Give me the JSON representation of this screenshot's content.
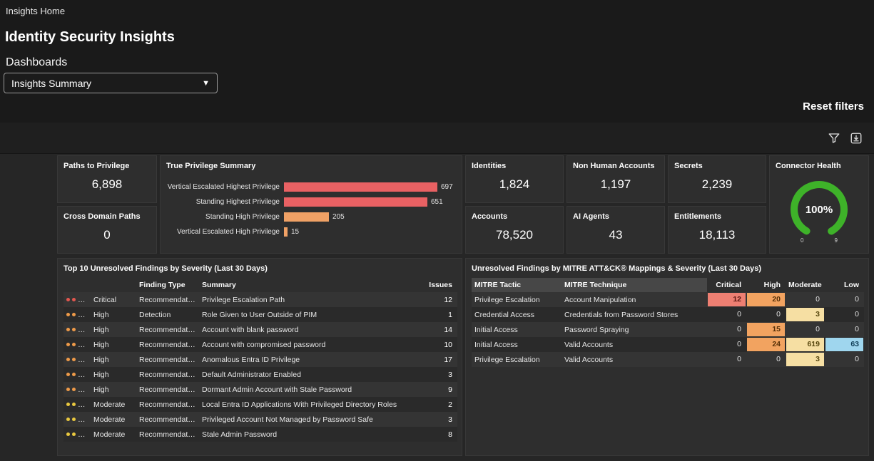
{
  "page": {
    "breadcrumb": "Insights Home",
    "title": "Identity Security Insights",
    "dashboards_label": "Dashboards",
    "dashboard_selected": "Insights Summary",
    "reset_filters": "Reset filters"
  },
  "toolbar": {
    "icons": [
      "filter-icon",
      "download-icon"
    ]
  },
  "kpis": [
    {
      "label": "Paths to Privilege",
      "value": "6,898"
    },
    {
      "label": "Cross Domain Paths",
      "value": "0"
    },
    {
      "label": "Identities",
      "value": "1,824"
    },
    {
      "label": "Accounts",
      "value": "78,520"
    },
    {
      "label": "Non Human Accounts",
      "value": "1,197"
    },
    {
      "label": "AI Agents",
      "value": "43"
    },
    {
      "label": "Secrets",
      "value": "2,239"
    },
    {
      "label": "Entitlements",
      "value": "18,113"
    }
  ],
  "connector_health": {
    "label": "Connector Health",
    "value": "100%",
    "gauge_min": "0",
    "gauge_max": "9",
    "color": "#3eb229"
  },
  "chart_data": [
    {
      "type": "bar",
      "title": "True Privilege Summary",
      "orientation": "horizontal",
      "categories": [
        "Vertical Escalated Highest Privilege",
        "Standing Highest Privilege",
        "Standing High Privilege",
        "Vertical Escalated High Privilege"
      ],
      "values": [
        697,
        651,
        205,
        15
      ],
      "value_labels": [
        "697",
        "651",
        "205",
        "15"
      ],
      "colors": [
        "#e96163",
        "#e96163",
        "#f0a165",
        "#f0a165"
      ],
      "xlim": [
        0,
        697
      ],
      "grid": false,
      "legend": false
    },
    {
      "type": "gauge",
      "title": "Connector Health",
      "value": 100,
      "unit": "%",
      "scale_min": 0,
      "scale_max": 9
    }
  ],
  "severity_colors": {
    "Critical": "#e2574f",
    "High": "#ee9a49",
    "Moderate": "#e9c83f"
  },
  "findings_table": {
    "title": "Top 10 Unresolved Findings by Severity (Last 30 Days)",
    "columns": {
      "finding_type": "Finding Type",
      "summary": "Summary",
      "issues": "Issues"
    },
    "dots_total": 4,
    "rows": [
      {
        "severity": "Critical",
        "dots": 4,
        "type": "Recommendation",
        "summary": "Privilege Escalation Path",
        "issues": "12"
      },
      {
        "severity": "High",
        "dots": 3,
        "type": "Detection",
        "summary": "Role Given to User Outside of PIM",
        "issues": "1"
      },
      {
        "severity": "High",
        "dots": 3,
        "type": "Recommendation",
        "summary": "Account with blank password",
        "issues": "14"
      },
      {
        "severity": "High",
        "dots": 3,
        "type": "Recommendation",
        "summary": "Account with compromised password",
        "issues": "10"
      },
      {
        "severity": "High",
        "dots": 3,
        "type": "Recommendation",
        "summary": "Anomalous Entra ID Privilege",
        "issues": "17"
      },
      {
        "severity": "High",
        "dots": 3,
        "type": "Recommendation",
        "summary": "Default Administrator Enabled",
        "issues": "3"
      },
      {
        "severity": "High",
        "dots": 3,
        "type": "Recommendation",
        "summary": "Dormant Admin Account with Stale Password",
        "issues": "9"
      },
      {
        "severity": "Moderate",
        "dots": 2,
        "type": "Recommendation",
        "summary": "Local Entra ID Applications With Privileged Directory Roles",
        "issues": "2"
      },
      {
        "severity": "Moderate",
        "dots": 2,
        "type": "Recommendation",
        "summary": "Privileged Account Not Managed by Password Safe",
        "issues": "3"
      },
      {
        "severity": "Moderate",
        "dots": 2,
        "type": "Recommendation",
        "summary": "Stale Admin Password",
        "issues": "8"
      }
    ]
  },
  "mitre_table": {
    "title": "Unresolved Findings by MITRE ATT&CK® Mappings & Severity (Last 30 Days)",
    "columns": [
      "MITRE Tactic",
      "MITRE Technique",
      "Critical",
      "High",
      "Moderate",
      "Low"
    ],
    "rows": [
      {
        "tactic": "Privilege Escalation",
        "technique": "Account Manipulation",
        "critical": 12,
        "high": 20,
        "moderate": 0,
        "low": 0
      },
      {
        "tactic": "Credential Access",
        "technique": "Credentials from Password Stores",
        "critical": 0,
        "high": 0,
        "moderate": 3,
        "low": 0
      },
      {
        "tactic": "Initial Access",
        "technique": "Password Spraying",
        "critical": 0,
        "high": 15,
        "moderate": 0,
        "low": 0
      },
      {
        "tactic": "Initial Access",
        "technique": "Valid Accounts",
        "critical": 0,
        "high": 24,
        "moderate": 619,
        "low": 63
      },
      {
        "tactic": "Privilege Escalation",
        "technique": "Valid Accounts",
        "critical": 0,
        "high": 0,
        "moderate": 3,
        "low": 0
      }
    ],
    "colors": {
      "critical": "#ee7f72",
      "high": "#f2a360",
      "moderate": "#f6dfa3",
      "low": "#9fd6ee"
    },
    "text_colors": {
      "critical": "#5a1510",
      "high": "#573008",
      "moderate": "#57470f",
      "low": "#0f3c55"
    }
  }
}
